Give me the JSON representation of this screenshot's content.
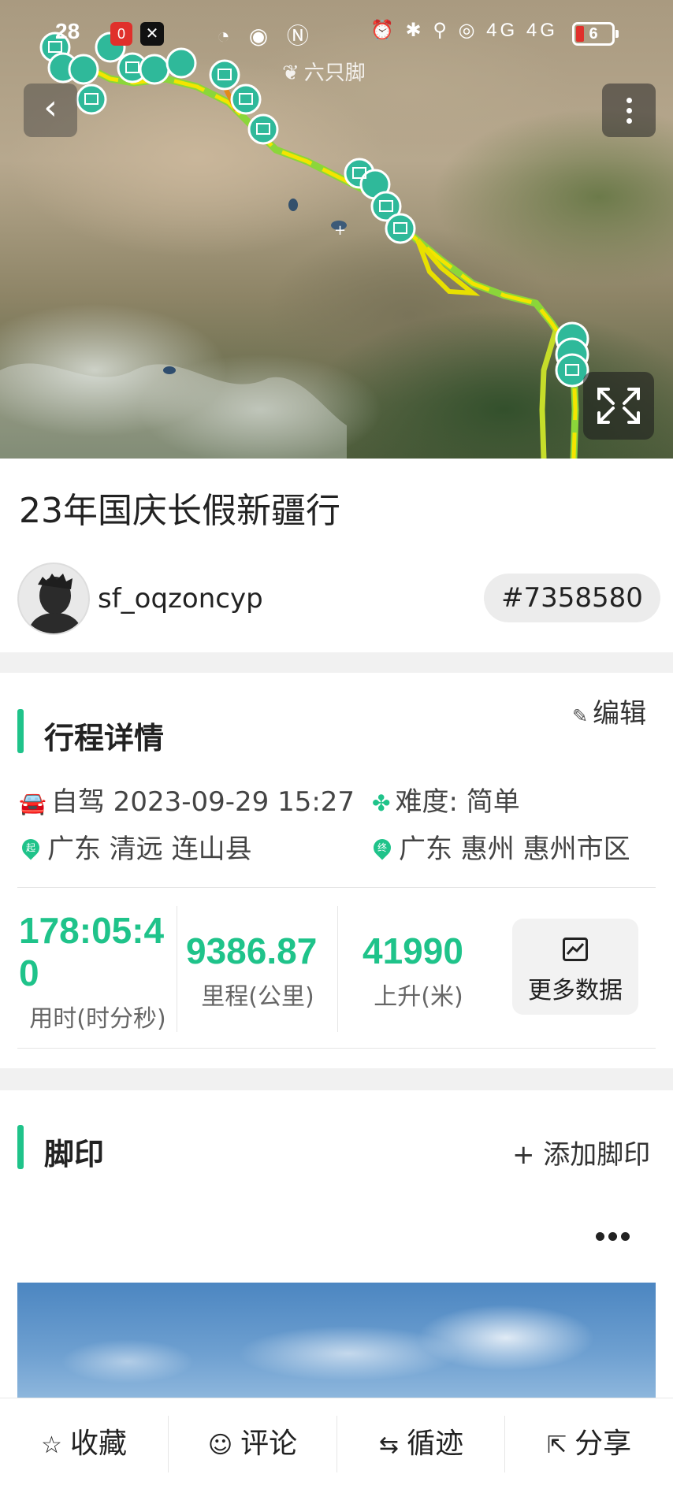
{
  "status_bar": {
    "time": "28",
    "notif_badge": "0",
    "mid_icons": "◔ ◉ Ⓝ",
    "right_icons": "⏰ ✱ ⚲ ◎ 4G 4G",
    "battery": "6"
  },
  "map": {
    "watermark": "六只脚",
    "back_icon": "chevron-left-icon",
    "more_icon": "more-vertical-icon",
    "fullscreen_icon": "expand-icon",
    "route_colors": [
      "#f3e500",
      "#8bd63a",
      "#e28a1a"
    ],
    "marker_color": "#2fb99a"
  },
  "trip": {
    "title": "23年国庆长假新疆行",
    "username": "sf_oqzoncyp",
    "id": "#7358580"
  },
  "details": {
    "section_title": "行程详情",
    "edit_label": "编辑",
    "mode": "自驾 2023-09-29 15:27",
    "difficulty": "难度:  简单",
    "start_pin": "起",
    "start": "广东 清远 连山县",
    "end_pin": "终",
    "end": "广东 惠州 惠州市区",
    "stats": [
      {
        "value": "178:05:4",
        "value2": "0",
        "label": "用时(时分秒)"
      },
      {
        "value": "9386.87",
        "label": "里程(公里)"
      },
      {
        "value": "41990",
        "label": "上升(米)"
      }
    ],
    "more_data_label": "更多数据"
  },
  "footprint": {
    "section_title": "脚印",
    "add_label": "+ 添加脚印"
  },
  "bottom_tabs": [
    {
      "icon": "star-icon",
      "glyph": "☆",
      "label": "收藏"
    },
    {
      "icon": "comment-icon",
      "glyph": "☺",
      "label": "评论"
    },
    {
      "icon": "loop-icon",
      "glyph": "⇆",
      "label": "循迹"
    },
    {
      "icon": "share-icon",
      "glyph": "⇱",
      "label": "分享"
    }
  ],
  "colors": {
    "accent": "#1fc38a",
    "text": "#222222"
  }
}
